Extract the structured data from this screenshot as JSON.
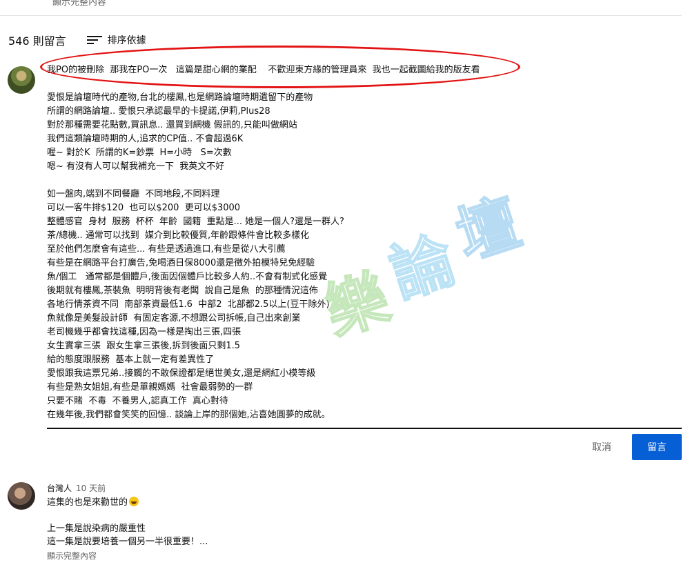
{
  "top_fragment": "顯示完整內容",
  "comments_header": {
    "count": "546 則留言",
    "sort_label": "排序依據"
  },
  "editor": {
    "lines": [
      "我PO的被刪除  那我在PO一次   這篇是甜心網的業配    不歡迎東方緣的管理員來  我也一起截圖給我的版友看",
      "",
      "愛恨是論壇時代的產物,台北的樓鳳,也是網路論壇時期遺留下的產物",
      "所謂的網路論壇.. 愛恨只承認最早的卡提諾,伊莉,Plus28",
      "對於那種需要花點數,買訊息.. 還買到網機 假訊的,只能叫做網站",
      "我們這類論壇時期的人,追求的CP值.. 不會超過6K",
      "喔~ 對於K  所謂的K=鈔票  H=小時   S=次數",
      "嗯~ 有沒有人可以幫我補充一下  我英文不好",
      "",
      "如一盤肉,端到不同餐廳  不同地段,不同料理",
      "可以一客牛排$120  也可以$200  更可以$3000",
      "整體感官  身材  服務  杯杯  年齡  國籍  重點是... 她是一個人?還是一群人?",
      "茶/總機.. 通常可以找到  媒介到比較優質,年齡跟條件會比較多樣化",
      "至於他們怎麼會有這些... 有些是透過進口,有些是從八大引薦",
      "有些是在網路平台打廣告,免喝酒日保8000還是徵外拍模特兒免經驗",
      "魚/個工   通常都是個體戶,後面因個體戶比較多人約..不會有制式化感覺",
      "後期就有樓鳳,茶裝魚  明明背後有老闆  說自己是魚  的那種情況這佈",
      "各地行情茶資不同  南部茶資最低1.6  中部2  北部都2.5以上(豆干除外)",
      "魚就像是美髮設計師  有固定客源,不想跟公司拆帳,自己出來創業",
      "老司機幾乎都會找這種,因為一樣是掏出三張,四張",
      "女生實拿三張  跟女生拿三張後,拆到後面只剩1.5",
      "給的態度跟服務  基本上就一定有差異性了",
      "愛恨跟我這票兄弟..接觸的不敢保證都是絕世美女,還是網紅小模等級",
      "有些是熟女姐姐,有些是單親媽媽  社會最弱勢的一群",
      "只要不賭  不毒  不養男人,認真工作  真心對待",
      "在幾年後,我們都會笑笑的回憶.. 談論上岸的那個她,沾喜她圓夢的成就。"
    ],
    "cancel_label": "取消",
    "submit_label": "留言"
  },
  "watermark": {
    "chars": [
      "樂",
      "論",
      "壇"
    ]
  },
  "comment2": {
    "author": "台灣人",
    "time": "10 天前",
    "line1": "這集的也是來勸世的",
    "line2": "",
    "line3": "上一集是說染病的嚴重性",
    "line4": "這一集是說要培養一個另一半很重要！...",
    "read_more": "顯示完整內容",
    "emoji_icon": "grinning-sweat-emoji"
  },
  "colors": {
    "accent": "#065fd4",
    "annotation": "#e31313"
  }
}
